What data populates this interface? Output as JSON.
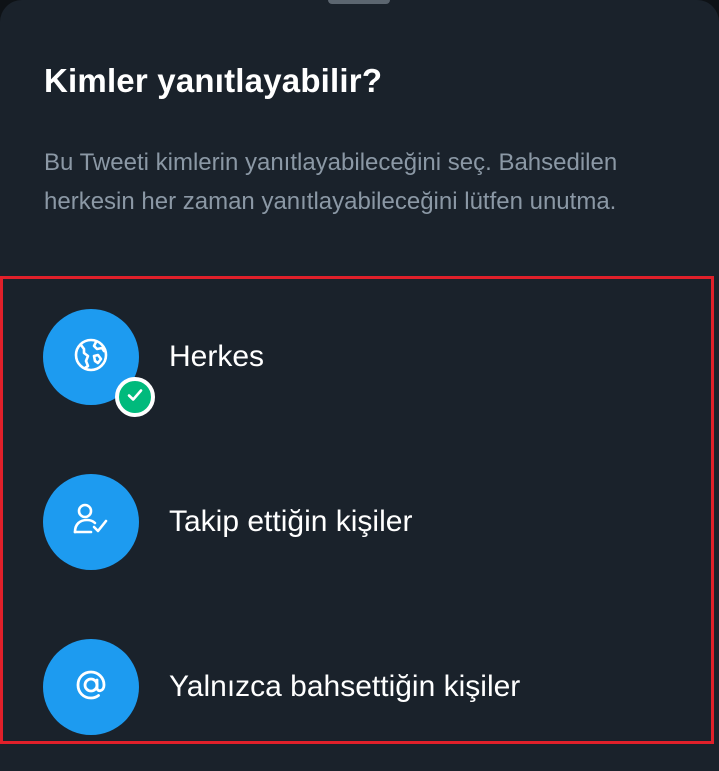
{
  "sheet": {
    "title": "Kimler yanıtlayabilir?",
    "description": "Bu Tweeti kimlerin yanıtlayabileceğini seç. Bahsedilen herkesin her zaman yanıtlayabileceğini lütfen unutma."
  },
  "options": [
    {
      "label": "Herkes",
      "icon": "globe-icon",
      "selected": true
    },
    {
      "label": "Takip ettiğin kişiler",
      "icon": "person-check-icon",
      "selected": false
    },
    {
      "label": "Yalnızca bahsettiğin kişiler",
      "icon": "at-sign-icon",
      "selected": false
    }
  ],
  "colors": {
    "background": "#1a222b",
    "accent": "#1d9bf0",
    "selected_check": "#00ba7c",
    "highlight_border": "#e0202a",
    "secondary_text": "#8b98a5"
  }
}
